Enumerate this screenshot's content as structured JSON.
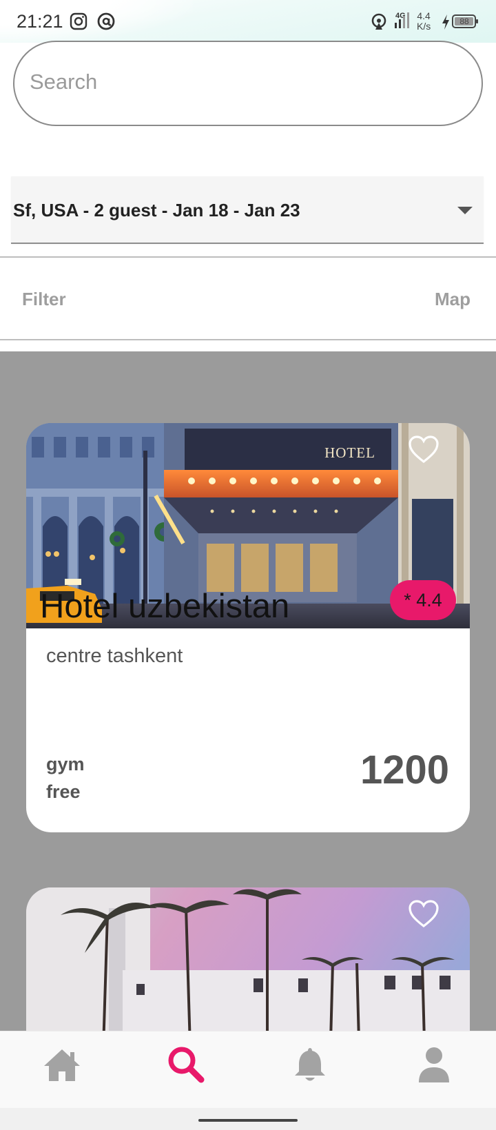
{
  "status_bar": {
    "time": "21:21",
    "network": "4G",
    "speed_value": "4.4",
    "speed_unit": "K/s",
    "battery": "88"
  },
  "search": {
    "placeholder": "Search",
    "value": ""
  },
  "trip_selector": {
    "selected": "Sf, USA - 2 guest - Jan 18 - Jan 23"
  },
  "toolbar": {
    "filter_label": "Filter",
    "map_label": "Map"
  },
  "hotels": [
    {
      "photo_sign": "HOTEL",
      "name": "Hotel uzbekistan",
      "rating": "* 4.4",
      "location": "centre tashkent",
      "amenity_1": "gym",
      "amenity_2": "free",
      "price": "1200",
      "favorite": false
    },
    {
      "favorite": false
    }
  ],
  "bottom_nav": {
    "items": [
      {
        "icon": "home-icon",
        "active": false
      },
      {
        "icon": "search-icon",
        "active": true
      },
      {
        "icon": "bell-icon",
        "active": false
      },
      {
        "icon": "user-icon",
        "active": false
      }
    ]
  },
  "colors": {
    "accent": "#e8196a",
    "list_background": "#9b9b9b",
    "muted_text": "#9e9e9e",
    "nav_inactive": "#a3a3a3"
  }
}
